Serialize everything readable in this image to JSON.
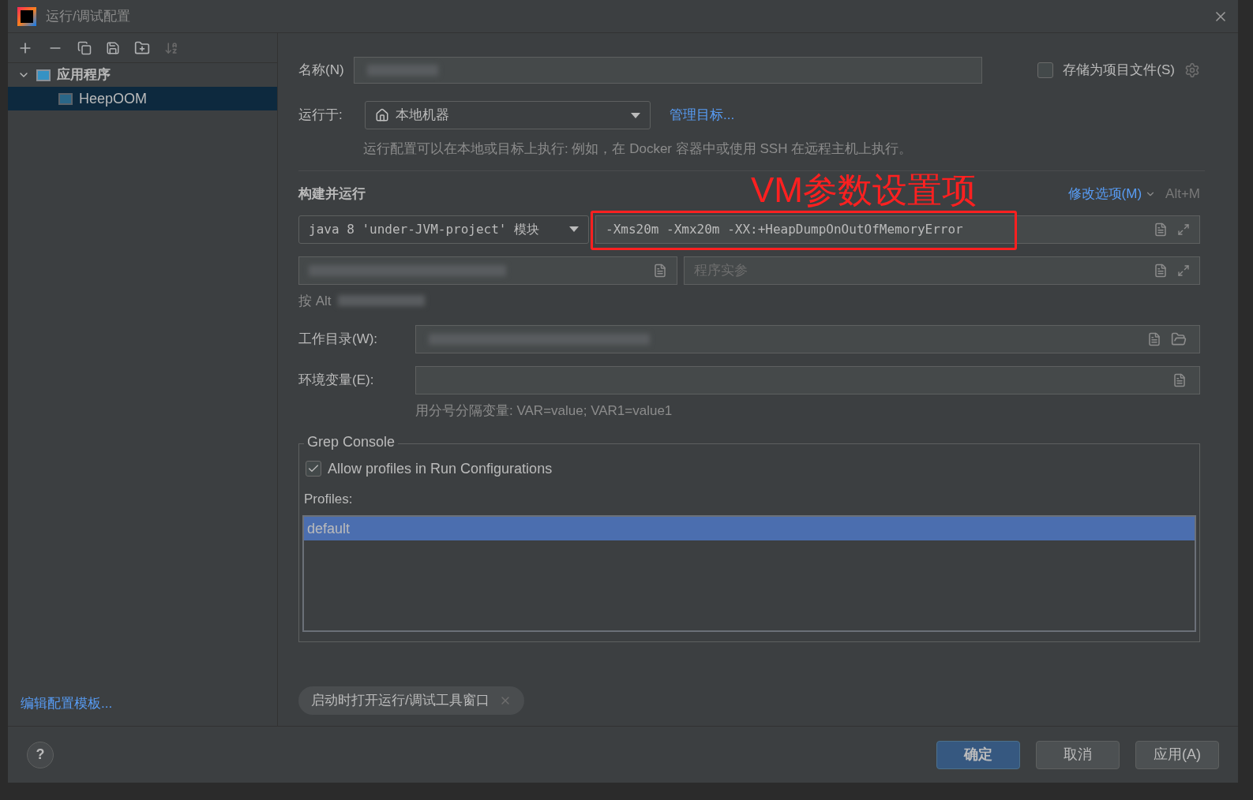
{
  "window": {
    "title": "运行/调试配置"
  },
  "tree": [
    {
      "label": "应用程序",
      "expanded": true,
      "selected": false,
      "children": [
        {
          "label": "HeepOOM",
          "selected": true
        }
      ]
    }
  ],
  "edit_templates_link": "编辑配置模板...",
  "form": {
    "name_label": "名称(N)",
    "save_as_project_file": {
      "label": "存储为项目文件(S)",
      "checked": false
    },
    "run_on": {
      "label": "运行于:",
      "value": "本地机器",
      "manage_link": "管理目标..."
    },
    "run_on_hint": "运行配置可以在本地或目标上执行: 例如，在 Docker 容器中或使用 SSH 在远程主机上执行。",
    "section_title": "构建并运行",
    "modify_options": {
      "label": "修改选项(M)",
      "shortcut": "Alt+M"
    },
    "jdk": "java 8 'under-JVM-project' 模块",
    "vm_options": "-Xms20m -Xmx20m -XX:+HeapDumpOnOutOfMemoryError",
    "program_args_placeholder": "程序实参",
    "alt_hint": "按 Alt",
    "working_dir_label": "工作目录(W):",
    "env_label": "环境变量(E):",
    "env_hint": "用分号分隔变量: VAR=value; VAR1=value1",
    "grep_console": {
      "title": "Grep Console",
      "allow_profiles": {
        "label": "Allow profiles in Run Configurations",
        "checked": true
      },
      "profiles_label": "Profiles:",
      "profiles": [
        {
          "name": "default",
          "selected": true
        }
      ]
    },
    "chip": "启动时打开运行/调试工具窗口"
  },
  "annotation": "VM参数设置项",
  "help": "?",
  "buttons": [
    {
      "label": "确定",
      "kind": "primary"
    },
    {
      "label": "取消",
      "kind": "secondary"
    },
    {
      "label": "应用(A)",
      "kind": "secondary"
    }
  ]
}
